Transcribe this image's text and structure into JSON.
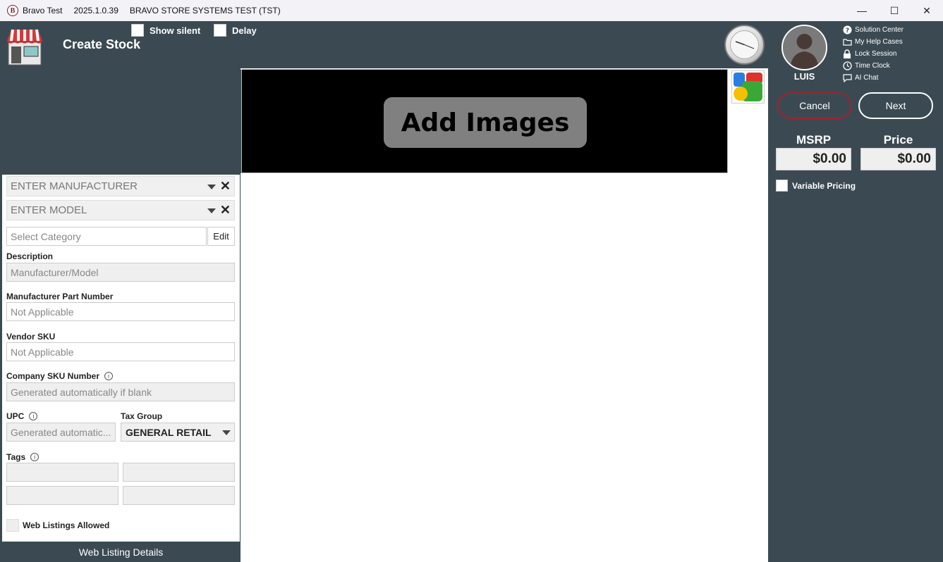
{
  "window": {
    "app_name": "Bravo Test",
    "version": "2025.1.0.39",
    "store": "BRAVO STORE SYSTEMS TEST (TST)",
    "logo_letter": "B",
    "minimize_glyph": "—",
    "maximize_glyph": "☐",
    "close_glyph": "✕"
  },
  "header": {
    "title": "Create Stock",
    "show_silent_label": "Show silent",
    "delay_label": "Delay",
    "user_name": "LUIS",
    "quick_links": [
      {
        "label": "Solution Center",
        "icon": "help-icon"
      },
      {
        "label": "My Help Cases",
        "icon": "folder-icon"
      },
      {
        "label": "Lock Session",
        "icon": "lock-icon"
      },
      {
        "label": "Time Clock",
        "icon": "clock-icon"
      },
      {
        "label": "AI Chat",
        "icon": "chat-icon"
      }
    ]
  },
  "images": {
    "add_label": "Add Images"
  },
  "form": {
    "manufacturer_placeholder": "ENTER MANUFACTURER",
    "model_placeholder": "ENTER MODEL",
    "clear_glyph": "✕",
    "category_placeholder": "Select Category",
    "edit_label": "Edit",
    "description_label": "Description",
    "description_value": "Manufacturer/Model",
    "mpn_label": "Manufacturer Part Number",
    "mpn_value": "Not Applicable",
    "vendor_sku_label": "Vendor SKU",
    "vendor_sku_value": "Not Applicable",
    "company_sku_label": "Company SKU Number",
    "company_sku_value": "Generated automatically if blank",
    "upc_label": "UPC",
    "upc_value": "Generated automatic...",
    "tax_group_label": "Tax Group",
    "tax_group_value": "GENERAL RETAIL",
    "tags_label": "Tags",
    "info_glyph": "i",
    "web_listings_label": "Web Listings Allowed",
    "web_listing_details": "Web Listing Details"
  },
  "actions": {
    "cancel_label": "Cancel",
    "next_label": "Next"
  },
  "pricing": {
    "msrp_label": "MSRP",
    "msrp_value": "$0.00",
    "price_label": "Price",
    "price_value": "$0.00",
    "variable_pricing_label": "Variable Pricing"
  },
  "colors": {
    "panel_bg": "#3b4a52",
    "cancel_border": "#a3212b"
  }
}
